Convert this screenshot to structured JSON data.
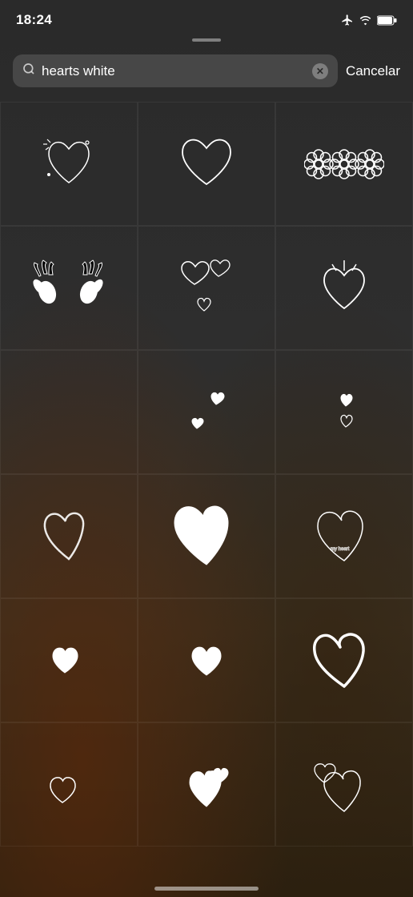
{
  "statusBar": {
    "time": "18:24",
    "cancelLabel": "Cancelar"
  },
  "searchBar": {
    "query": "hearts white",
    "clearButtonLabel": "×"
  },
  "stickers": [
    {
      "id": 1,
      "description": "sparkle heart outline small",
      "row": 1,
      "col": 1
    },
    {
      "id": 2,
      "description": "simple heart outline",
      "row": 1,
      "col": 2
    },
    {
      "id": 3,
      "description": "three flowers",
      "row": 1,
      "col": 3
    },
    {
      "id": 4,
      "description": "hands with claws",
      "row": 2,
      "col": 1
    },
    {
      "id": 5,
      "description": "multiple small hearts",
      "row": 2,
      "col": 2
    },
    {
      "id": 6,
      "description": "heart with arrow down",
      "row": 2,
      "col": 3
    },
    {
      "id": 7,
      "description": "empty",
      "row": 3,
      "col": 1
    },
    {
      "id": 8,
      "description": "two tiny hearts scattered",
      "row": 3,
      "col": 2
    },
    {
      "id": 9,
      "description": "tiny hearts right",
      "row": 3,
      "col": 3
    },
    {
      "id": 10,
      "description": "chalky heart outline",
      "row": 4,
      "col": 1
    },
    {
      "id": 11,
      "description": "solid white heart",
      "row": 4,
      "col": 2
    },
    {
      "id": 12,
      "description": "heart outline with text",
      "row": 4,
      "col": 3
    },
    {
      "id": 13,
      "description": "small white heart left",
      "row": 5,
      "col": 1
    },
    {
      "id": 14,
      "description": "small heart center",
      "row": 5,
      "col": 2
    },
    {
      "id": 15,
      "description": "bold brush heart",
      "row": 5,
      "col": 3
    },
    {
      "id": 16,
      "description": "small heart outline bottom left",
      "row": 6,
      "col": 1
    },
    {
      "id": 17,
      "description": "two hearts cluster bottom center",
      "row": 6,
      "col": 2
    },
    {
      "id": 18,
      "description": "two hearts outline bottom right",
      "row": 6,
      "col": 3
    }
  ]
}
